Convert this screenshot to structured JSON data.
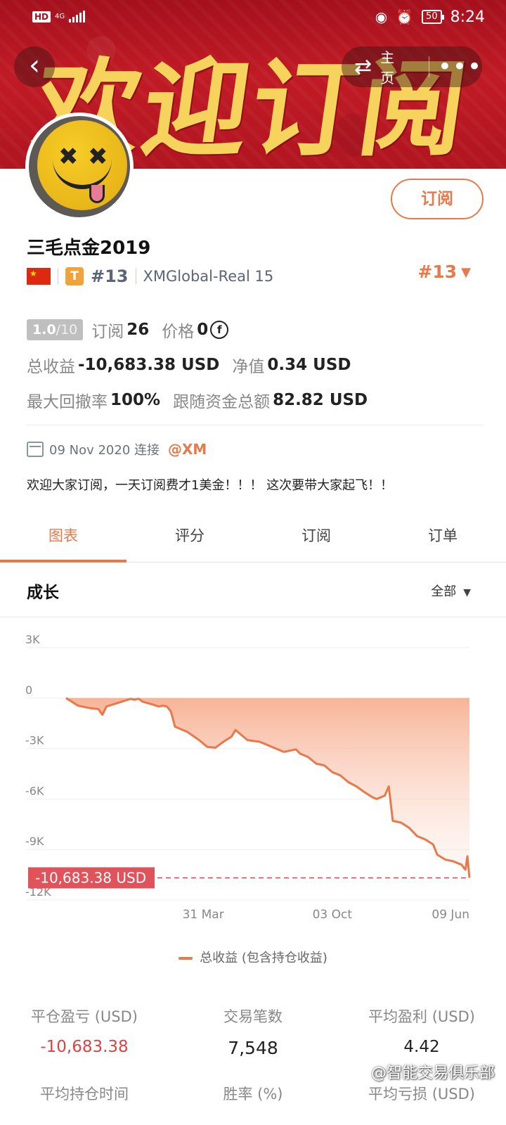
{
  "status_bar": {
    "hd": "HD",
    "network": "4G",
    "battery": "50",
    "time": "8:24"
  },
  "banner": {
    "art_text": "欢迎订阅"
  },
  "nav": {
    "back_icon": "chevron-left-icon",
    "swap_icon": "swap-icon",
    "home_label": "主页",
    "more_icon": "more-icon"
  },
  "profile": {
    "subscribe_label": "订阅",
    "name": "三毛点金2019",
    "tier": "T",
    "rank": "#13",
    "account": "XMGlobal-Real 15",
    "rank_right": "#13",
    "rating_num": "1.0",
    "rating_den": "/10",
    "subs_label": "订阅",
    "subs_value": "26",
    "price_label": "价格",
    "price_value": "0",
    "total_profit_label": "总收益",
    "total_profit_value": "-10,683.38 USD",
    "equity_label": "净值",
    "equity_value": "0.34 USD",
    "max_drawdown_label": "最大回撤率",
    "max_drawdown_value": "100%",
    "follow_funds_label": "跟随资金总额",
    "follow_funds_value": "82.82 USD",
    "connect_date": "09 Nov 2020 连接",
    "broker": "@XM",
    "description": "欢迎大家订阅，一天订阅费才1美金！！！ 这次要带大家起飞！！"
  },
  "tabs": [
    {
      "label": "图表",
      "active": true
    },
    {
      "label": "评分",
      "active": false
    },
    {
      "label": "订阅",
      "active": false
    },
    {
      "label": "订单",
      "active": false
    }
  ],
  "growth": {
    "title": "成长",
    "filter": "全部"
  },
  "chart_data": {
    "type": "area",
    "title": "",
    "xlabel": "",
    "ylabel": "",
    "ylim": [
      -12000,
      3000
    ],
    "y_ticks": [
      "3K",
      "0",
      "-3K",
      "-6K",
      "-9K",
      "-12K"
    ],
    "x_ticks": [
      "31 Mar",
      "03 Oct",
      "09 Jun"
    ],
    "series": [
      {
        "name": "总收益 (包含持仓收益)",
        "color": "#e8794a",
        "points": [
          [
            0,
            0
          ],
          [
            0.03,
            -450
          ],
          [
            0.06,
            -600
          ],
          [
            0.08,
            -650
          ],
          [
            0.09,
            -1000
          ],
          [
            0.1,
            -500
          ],
          [
            0.12,
            -350
          ],
          [
            0.14,
            -200
          ],
          [
            0.16,
            -50
          ],
          [
            0.17,
            -100
          ],
          [
            0.18,
            -40
          ],
          [
            0.19,
            -220
          ],
          [
            0.21,
            -350
          ],
          [
            0.23,
            -500
          ],
          [
            0.24,
            -450
          ],
          [
            0.25,
            -500
          ],
          [
            0.26,
            -800
          ],
          [
            0.27,
            -1700
          ],
          [
            0.3,
            -2000
          ],
          [
            0.33,
            -2500
          ],
          [
            0.35,
            -2900
          ],
          [
            0.37,
            -2950
          ],
          [
            0.39,
            -2600
          ],
          [
            0.41,
            -2300
          ],
          [
            0.42,
            -1900
          ],
          [
            0.43,
            -2100
          ],
          [
            0.45,
            -2500
          ],
          [
            0.48,
            -2600
          ],
          [
            0.5,
            -2800
          ],
          [
            0.52,
            -3000
          ],
          [
            0.54,
            -3200
          ],
          [
            0.55,
            -3150
          ],
          [
            0.57,
            -3050
          ],
          [
            0.58,
            -3300
          ],
          [
            0.6,
            -3500
          ],
          [
            0.62,
            -3900
          ],
          [
            0.64,
            -4000
          ],
          [
            0.66,
            -4400
          ],
          [
            0.68,
            -4600
          ],
          [
            0.7,
            -5000
          ],
          [
            0.72,
            -5250
          ],
          [
            0.74,
            -5600
          ],
          [
            0.76,
            -5900
          ],
          [
            0.77,
            -6000
          ],
          [
            0.79,
            -5800
          ],
          [
            0.8,
            -5250
          ],
          [
            0.81,
            -7300
          ],
          [
            0.83,
            -7400
          ],
          [
            0.85,
            -7700
          ],
          [
            0.87,
            -8200
          ],
          [
            0.89,
            -8400
          ],
          [
            0.91,
            -8700
          ],
          [
            0.92,
            -9300
          ],
          [
            0.94,
            -9600
          ],
          [
            0.96,
            -9700
          ],
          [
            0.98,
            -9900
          ],
          [
            0.99,
            -10200
          ],
          [
            0.995,
            -9400
          ],
          [
            1,
            -10683.38
          ]
        ]
      }
    ],
    "annotation_value": "-10,683.38 USD",
    "grid": true,
    "legend_position": "bottom"
  },
  "summary": [
    {
      "label": "平仓盈亏 (USD)",
      "value": "-10,683.38",
      "negative": true
    },
    {
      "label": "交易笔数",
      "value": "7,548",
      "negative": false
    },
    {
      "label": "平均盈利 (USD)",
      "value": "4.42",
      "negative": false
    }
  ],
  "summary2": [
    {
      "label": "平均持仓时间"
    },
    {
      "label": "胜率 (%)"
    },
    {
      "label": "平均亏损 (USD)"
    }
  ],
  "watermark": "@智能交易俱乐部"
}
